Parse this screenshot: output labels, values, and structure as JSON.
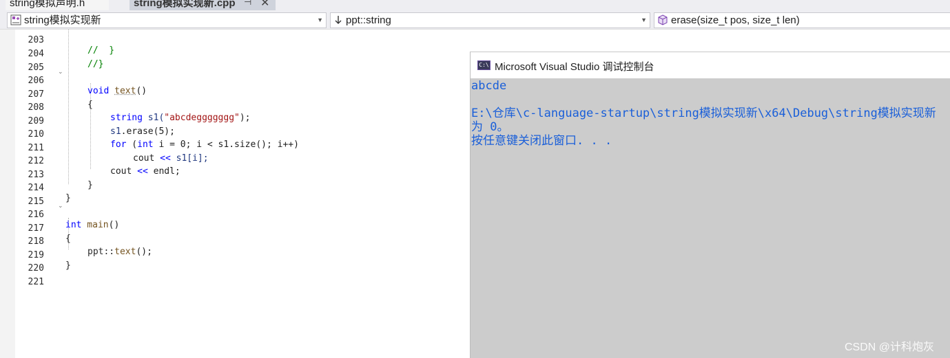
{
  "tabs": {
    "tab1_label": "string模拟声明.h",
    "tab2_label": "string模拟实现新.cpp",
    "pin_icon": "pin-icon",
    "close_icon": "close-icon"
  },
  "navbar": {
    "project_label": "string模拟实现新",
    "scope_label": "ppt::string",
    "member_label": "erase(size_t pos, size_t len)"
  },
  "editor": {
    "line_numbers": [
      "203",
      "204",
      "205",
      "206",
      "207",
      "208",
      "209",
      "210",
      "211",
      "212",
      "213",
      "214",
      "215",
      "216",
      "217",
      "218",
      "219",
      "220",
      "221"
    ],
    "line_203": "//  }",
    "line_204": "//}",
    "line_206_kw": "void",
    "line_206_fn": "text",
    "line_206_rest": "()",
    "line_207": "{",
    "line_208_kw": "string",
    "line_208_var": "s1(",
    "line_208_str": "\"abcdeggggggg\"",
    "line_208_end": ");",
    "line_209_var": "s1",
    "line_209_rest": ".erase(5);",
    "line_210_kw1": "for",
    "line_210_p1": " (",
    "line_210_kw2": "int",
    "line_210_rest": " i = 0; i < s1.size(); i++)",
    "line_211_a": "cout",
    "line_211_op": " << ",
    "line_211_b": "s1[i];",
    "line_212_a": "cout",
    "line_212_op": " << ",
    "line_212_b": "endl;",
    "line_213": "}",
    "line_214": "}",
    "line_216_kw": "int",
    "line_216_fn": " main",
    "line_216_rest": "()",
    "line_217": "{",
    "line_218_ns": "ppt::",
    "line_218_fn": "text",
    "line_218_rest": "();",
    "line_219": "}"
  },
  "console": {
    "title": "Microsoft Visual Studio 调试控制台",
    "icon_label": "C:\\",
    "output_line1": "abcde",
    "output_line2": "",
    "output_line3": "E:\\仓库\\c-language-startup\\string模拟实现新\\x64\\Debug\\string模拟实现新",
    "output_line4": "为 0。",
    "output_line5": "按任意键关闭此窗口. . ."
  },
  "watermark": "CSDN @计科炮灰",
  "colors": {
    "keyword": "#0000ff",
    "string": "#a31515",
    "comment": "#008000",
    "console_text": "#1a5fd9",
    "console_bg": "#cccccc"
  }
}
